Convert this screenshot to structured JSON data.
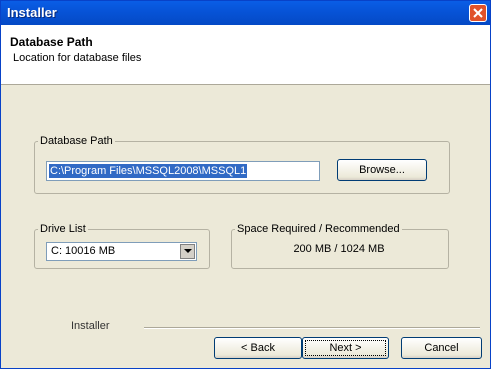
{
  "window": {
    "title": "Installer"
  },
  "header": {
    "title": "Database Path",
    "subtitle": "Location for database files"
  },
  "db_path": {
    "legend": "Database Path",
    "value": "C:\\Program Files\\MSSQL2008\\MSSQL1",
    "browse_label": "Browse..."
  },
  "drive_list": {
    "legend": "Drive List",
    "selected": "C:  10016 MB"
  },
  "space": {
    "legend": "Space Required / Recommended",
    "value": "200 MB / 1024 MB"
  },
  "footer": {
    "label": "Installer",
    "back_label": "< Back",
    "next_label": "Next >",
    "cancel_label": "Cancel"
  },
  "icons": {
    "close": "close-icon",
    "dropdown": "chevron-down-icon"
  },
  "colors": {
    "titlebar": "#0754d8",
    "selection": "#316ac5",
    "dialog_bg": "#ece9d8"
  }
}
